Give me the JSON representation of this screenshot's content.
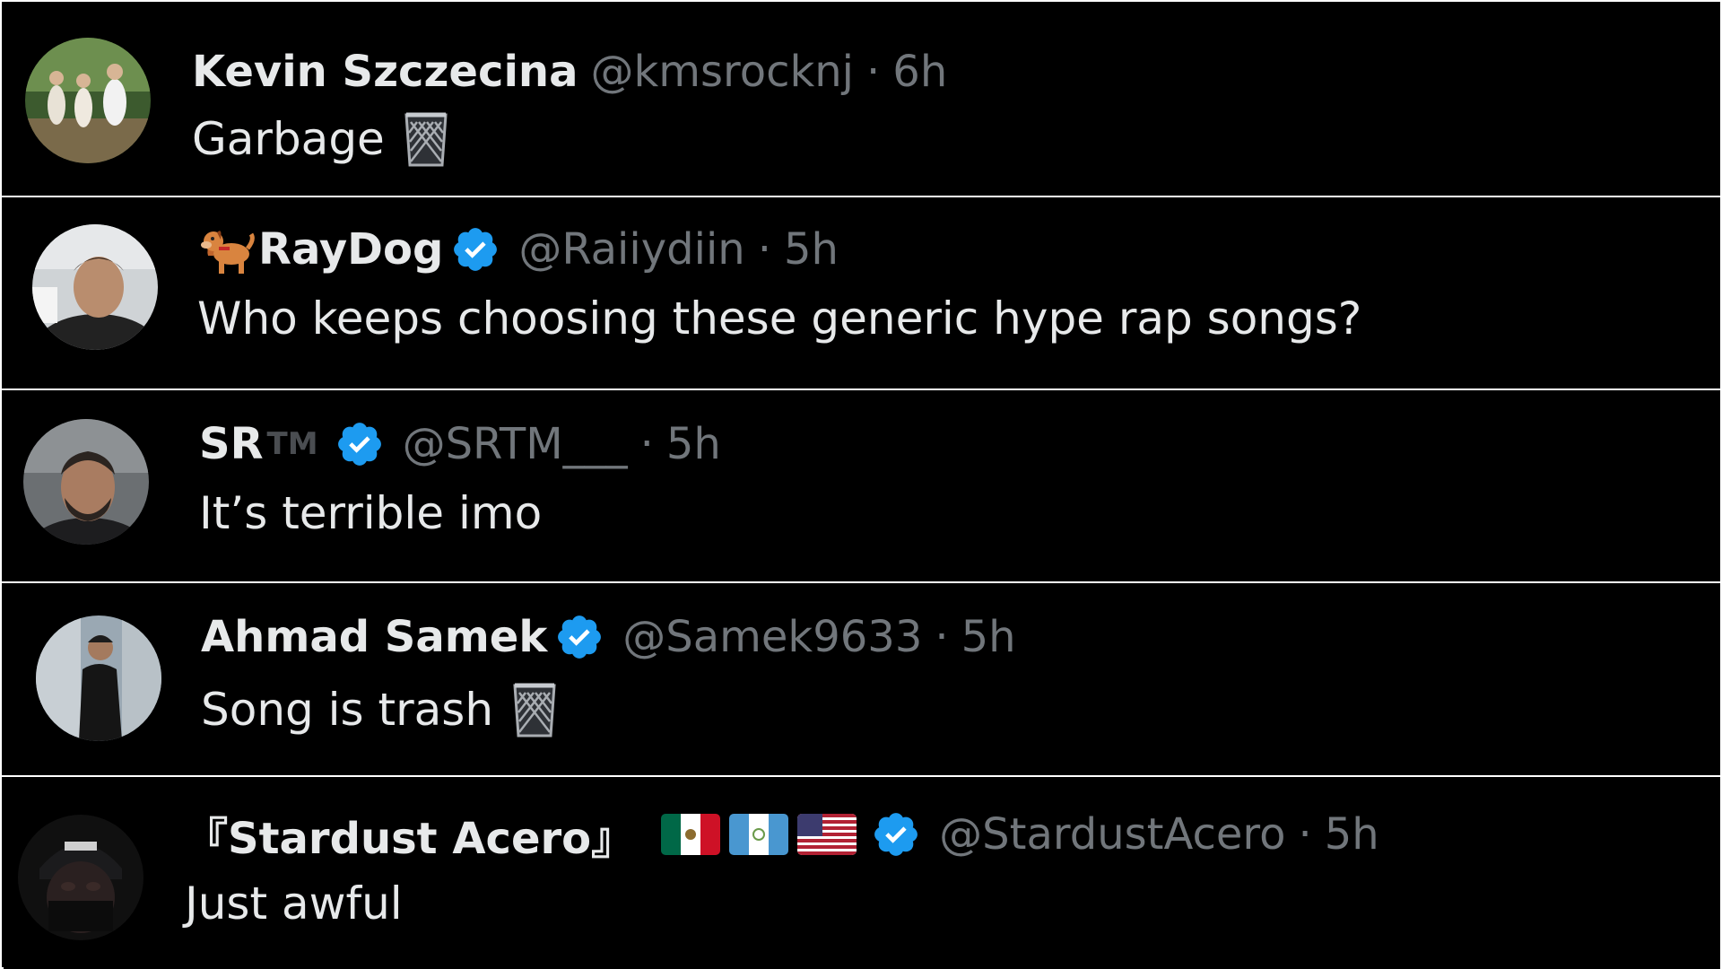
{
  "colors": {
    "background": "#000000",
    "divider": "#ffffff",
    "name": "#e7e9ea",
    "handle": "#71767b",
    "verified": "#1d9bf0"
  },
  "tweets": [
    {
      "name": "Kevin Szczecina",
      "handle": "@kmsrocknj",
      "separator": "·",
      "time": "6h",
      "text": "Garbage",
      "verified": false,
      "text_emoji": "wastebasket-icon"
    },
    {
      "name_prefix_emoji": "dog-icon",
      "name": "RayDog",
      "handle": "@Raiiydiin",
      "separator": "·",
      "time": "5h",
      "text": "Who keeps choosing these generic hype rap songs?",
      "verified": true
    },
    {
      "name": "SR",
      "name_suffix": "TM",
      "handle": "@SRTM___",
      "separator": "·",
      "time": "5h",
      "text": "It’s terrible imo",
      "verified": true
    },
    {
      "name": "Ahmad Samek",
      "handle": "@Samek9633",
      "separator": "·",
      "time": "5h",
      "text": "Song is trash",
      "verified": true,
      "text_emoji": "wastebasket-icon"
    },
    {
      "name": "『Stardust Acero』",
      "flags": [
        "mexico-flag-icon",
        "guatemala-flag-icon",
        "usa-flag-icon"
      ],
      "handle": "@StardustAcero",
      "separator": "·",
      "time": "5h",
      "text": "Just awful",
      "verified": true
    }
  ]
}
